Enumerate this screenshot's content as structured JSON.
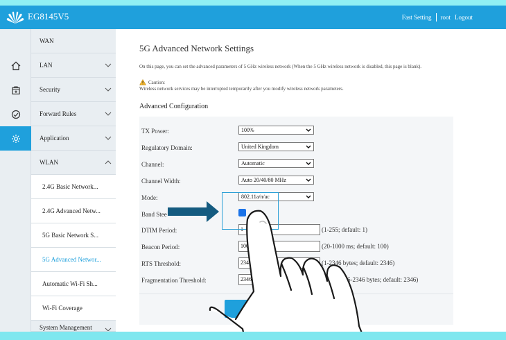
{
  "header": {
    "brand": "EG8145V5",
    "links": [
      "Fast Setting",
      "root",
      "Logout"
    ]
  },
  "menu": {
    "items": [
      {
        "label": "WAN",
        "chevron": false
      },
      {
        "label": "LAN",
        "chevron": "down"
      },
      {
        "label": "Security",
        "chevron": "down"
      },
      {
        "label": "Forward Rules",
        "chevron": "down"
      },
      {
        "label": "Application",
        "chevron": "down"
      },
      {
        "label": "WLAN",
        "chevron": "up"
      }
    ],
    "subitems": [
      "2.4G Basic Network...",
      "2.4G Advanced Netw...",
      "5G Basic Network S...",
      "5G Advanced Networ...",
      "Automatic Wi-Fi Sh...",
      "Wi-Fi Coverage"
    ],
    "partial": "System Management",
    "icons": [
      "home-icon",
      "security-icon",
      "forward-icon",
      "gear-icon"
    ]
  },
  "page": {
    "title": "5G Advanced Network Settings",
    "description": "On this page, you can set the advanced parameters of 5 GHz wireless network (When the 5 GHz wireless network is disabled, this page is blank).",
    "caution_label": "Caution:",
    "caution_text": "Wireless network services may be interrupted temporarily after you modify wireless network parameters.",
    "section": "Advanced Configuration"
  },
  "form": {
    "tx_power_label": "TX Power:",
    "tx_power_value": "100%",
    "regulatory_label": "Regulatory Domain:",
    "regulatory_value": "United Kingdom",
    "channel_label": "Channel:",
    "channel_value": "Automatic",
    "channel_width_label": "Channel Width:",
    "channel_width_value": "Auto 20/40/80 MHz",
    "mode_label": "Mode:",
    "mode_value": "802.11a/n/ac",
    "band_steering_label": "Band Steering:",
    "band_steering_visible": "Band Stee",
    "band_steering_checked": true,
    "dtim_label": "DTIM Period:",
    "dtim_value": "1",
    "dtim_hint": "(1-255; default: 1)",
    "beacon_label": "Beacon Period:",
    "beacon_value": "100",
    "beacon_hint": "(20-1000 ms; default: 100)",
    "rts_label": "RTS Threshold:",
    "rts_value": "2346",
    "rts_hint": "(1-2346 bytes; default: 2346)",
    "frag_label": "Fragmentation Threshold:",
    "frag_value": "2346",
    "frag_hint": "256-2346 bytes; default: 2346)",
    "apply_label": "Ap"
  },
  "colors": {
    "header": "#1fa0dc",
    "accent": "#1fa0dc",
    "arrow": "#145b80"
  }
}
